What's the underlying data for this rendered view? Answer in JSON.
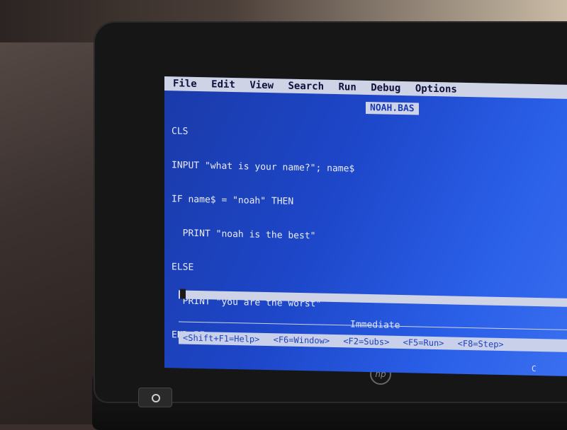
{
  "menu": {
    "items": [
      "File",
      "Edit",
      "View",
      "Search",
      "Run",
      "Debug",
      "Options"
    ]
  },
  "editor": {
    "filename": "NOAH.BAS",
    "lines": [
      "CLS",
      "INPUT \"what is your name?\"; name$",
      "IF name$ = \"noah\" THEN",
      "  PRINT \"noah is the best\"",
      "ELSE",
      "  PRINT \"you are the worst\"",
      "END IF"
    ]
  },
  "immediate": {
    "title": "Immediate"
  },
  "statusbar": {
    "items": [
      "<Shift+F1=Help>",
      "<F6=Window>",
      "<F2=Subs>",
      "<F5=Run>",
      "<F8=Step>"
    ]
  },
  "indicator": {
    "text": "C"
  }
}
